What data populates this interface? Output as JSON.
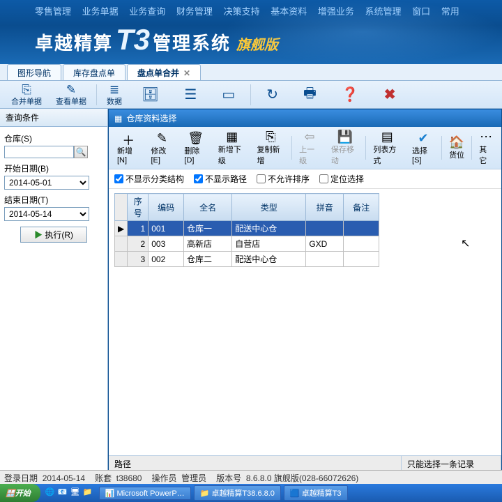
{
  "topMenu": [
    "零售管理",
    "业务单据",
    "业务查询",
    "财务管理",
    "决策支持",
    "基本资料",
    "增强业务",
    "系统管理",
    "窗口",
    "常用"
  ],
  "brand": {
    "b1": "卓越精算",
    "t3": "T3",
    "b2": "管理系统",
    "b3": "旗舰版"
  },
  "tabs": [
    {
      "label": "图形导航",
      "active": false,
      "closable": false
    },
    {
      "label": "库存盘点单",
      "active": false,
      "closable": false
    },
    {
      "label": "盘点单合并",
      "active": true,
      "closable": true
    }
  ],
  "toolbarMain": {
    "merge": "合并单据",
    "view": "查看单据",
    "data": "数据"
  },
  "sidebar": {
    "panelTitle": "查询条件",
    "warehouseLabel": "仓库(S)",
    "startLabel": "开始日期(B)",
    "startDate": "2014-05-01",
    "endLabel": "结束日期(T)",
    "endDate": "2014-05-14",
    "execLabel": "执行(R)"
  },
  "dialog": {
    "title": "仓库资料选择",
    "toolbar": {
      "add": "新增[N]",
      "edit": "修改[E]",
      "del": "删除[D]",
      "addChild": "新增下级",
      "copyAdd": "复制新增",
      "up": "上一级",
      "saveMove": "保存移动",
      "listMode": "列表方式",
      "select": "选择[S]",
      "location": "货位",
      "other": "其它"
    },
    "filters": {
      "hideTree": "不显示分类结构",
      "hidePath": "不显示路径",
      "noSort": "不允许排序",
      "locateSel": "定位选择"
    },
    "columns": [
      "序号",
      "编码",
      "全名",
      "类型",
      "拼音",
      "备注"
    ],
    "rows": [
      {
        "n": "1",
        "code": "001",
        "name": "仓库一",
        "type": "配送中心仓",
        "py": "",
        "note": "",
        "sel": true
      },
      {
        "n": "2",
        "code": "003",
        "name": "高新店",
        "type": "自营店",
        "py": "GXD",
        "note": "",
        "sel": false
      },
      {
        "n": "3",
        "code": "002",
        "name": "仓库二",
        "type": "配送中心仓",
        "py": "",
        "note": "",
        "sel": false
      }
    ],
    "status": {
      "pathLabel": "路径",
      "hint": "只能选择一条记录"
    }
  },
  "statusbar": {
    "loginDateLabel": "登录日期",
    "loginDate": "2014-05-14",
    "acctLabel": "账套",
    "acct": "t38680",
    "operLabel": "操作员",
    "oper": "管理员",
    "verLabel": "版本号",
    "ver": "8.6.8.0 旗舰版(028-66072626)"
  },
  "taskbar": {
    "start": "开始",
    "tasks": [
      "Microsoft PowerP…",
      "卓越精算T38.6.8.0",
      "卓越精算T3"
    ]
  }
}
